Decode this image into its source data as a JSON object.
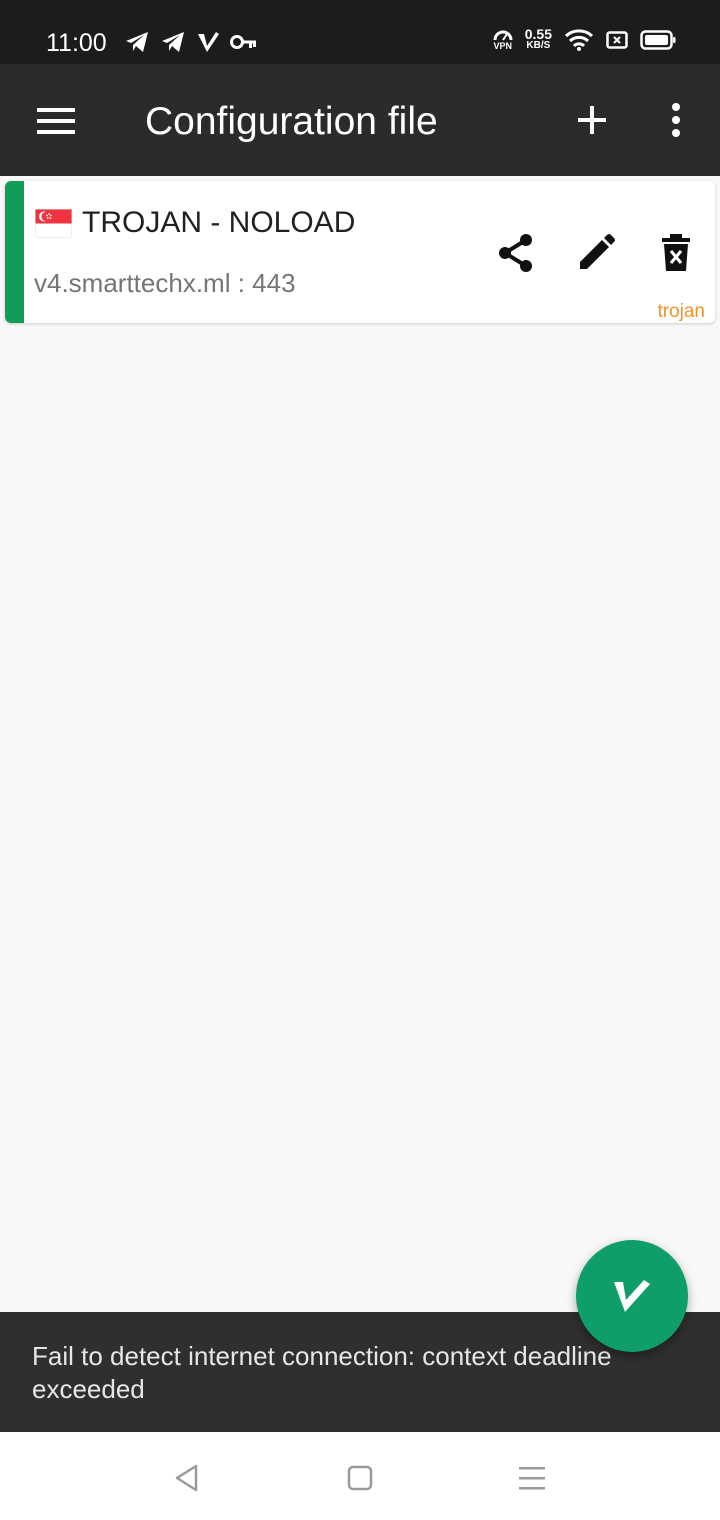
{
  "status_bar": {
    "time": "11:00",
    "vpn_label": "VPN",
    "speed_value": "0.55",
    "speed_unit": "KB/S",
    "icons": [
      "telegram-icon",
      "telegram-icon",
      "v2ray-icon",
      "key-icon",
      "vpn-gauge-icon",
      "wifi-icon",
      "screen-record-icon",
      "battery-icon"
    ]
  },
  "app_bar": {
    "title": "Configuration file",
    "icons": [
      "menu-icon",
      "add-icon",
      "more-vert-icon"
    ]
  },
  "servers": [
    {
      "flag": "singapore-flag",
      "name": "TROJAN - NOLOAD",
      "address": "v4.smarttechx.ml : 443",
      "type": "trojan",
      "selected": true
    }
  ],
  "card_actions": [
    "share-icon",
    "edit-icon",
    "delete-icon"
  ],
  "snackbar": {
    "message": "Fail to detect internet connection:  context deadline exceeded"
  },
  "fab": {
    "icon": "v2ray-logo-icon"
  },
  "nav_bar": {
    "icons": [
      "back-icon",
      "home-icon",
      "recents-icon"
    ]
  },
  "colors": {
    "app_bar": "#2b2b2b",
    "status_bar": "#1c1c1c",
    "accent_green": "#0f9d58",
    "fab": "#0f9d6a",
    "type_label": "#f0932b",
    "snackbar": "#2f2f2f",
    "background": "#f8f8f8"
  }
}
